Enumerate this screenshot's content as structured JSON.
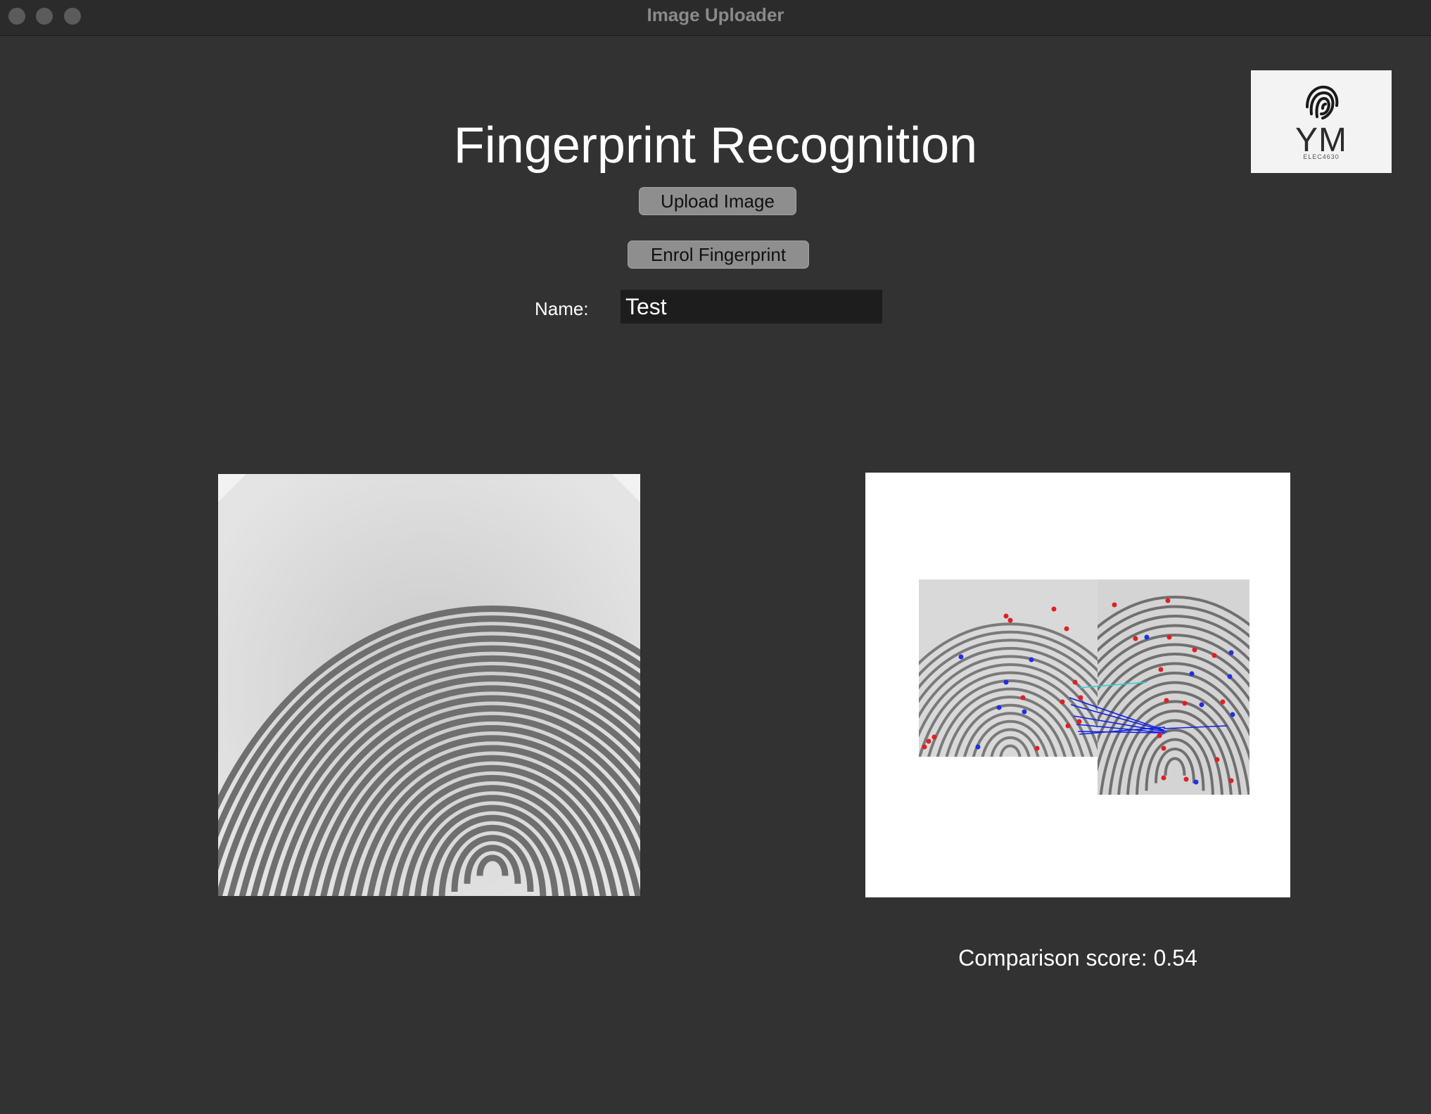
{
  "window": {
    "title": "Image Uploader"
  },
  "header": {
    "title": "Fingerprint Recognition"
  },
  "logo": {
    "letters": "YM",
    "subtitle": "ELEC4630",
    "icon": "fingerprint-icon"
  },
  "actions": {
    "upload_label": "Upload Image",
    "enrol_label": "Enrol Fingerprint"
  },
  "form": {
    "name_label": "Name:",
    "name_value": "Test"
  },
  "result": {
    "score_text": "Comparison score: 0.54"
  },
  "colors": {
    "background": "#323232",
    "input_bg": "#1d1d1d",
    "button_bg": "#8e8e8e",
    "minutia_red": "#e02020",
    "minutia_blue": "#2030e0",
    "match_line_blue": "#1020e8",
    "match_line_cyan": "#30d0d0"
  }
}
